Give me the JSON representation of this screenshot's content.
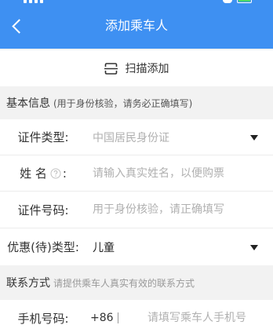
{
  "colors": {
    "header_bg": "#3e90f2",
    "page_bg": "#f2f2f2",
    "battery_fill": "#4cd964",
    "placeholder": "#b0b0b0"
  },
  "status_bar": {
    "icons": [
      "signal-icon",
      "wifi-icon",
      "battery-icon"
    ]
  },
  "header": {
    "back_icon": "chevron-left-icon",
    "title": "添加乘车人"
  },
  "scan": {
    "icon": "scan-icon",
    "label": "扫描添加"
  },
  "basic_section": {
    "title": "基本信息",
    "note": "(用于身份核验，请务必正确填写)"
  },
  "fields": {
    "id_type": {
      "label": "证件类型:",
      "value": "中国居民身份证",
      "icon": "dropdown-triangle-icon"
    },
    "name": {
      "label": "姓 名",
      "colon": ":",
      "help_icon": "help-circle-icon",
      "placeholder": "请输入真实姓名，以便购票"
    },
    "id_number": {
      "label": "证件号码:",
      "placeholder": "用于身份核验，请正确填写"
    },
    "discount_type": {
      "label": "优惠(待)类型:",
      "value": "儿童",
      "icon": "dropdown-triangle-icon"
    }
  },
  "contact_section": {
    "title": "联系方式",
    "note": "请提供乘车人真实有效的联系方式"
  },
  "phone": {
    "label": "手机号码:",
    "country_code": "+86",
    "placeholder": "请填写乘车人手机号"
  }
}
